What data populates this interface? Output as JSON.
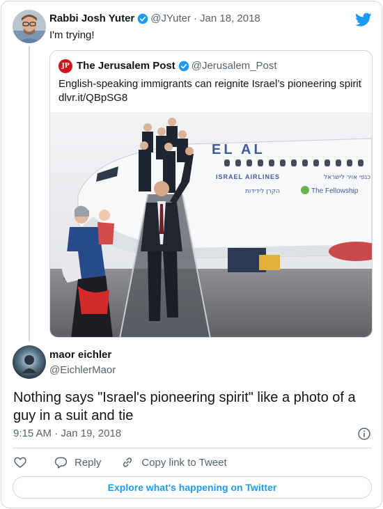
{
  "parent": {
    "name": "Rabbi Josh Yuter",
    "handle": "@JYuter",
    "separator": "·",
    "date": "Jan 18, 2018",
    "text": "I'm trying!"
  },
  "quoted": {
    "name": "The Jerusalem Post",
    "handle": "@Jerusalem_Post",
    "logo_text": "JP",
    "text": "English-speaking immigrants can reignite Israel’s pioneering spirit",
    "link": "dlvr.it/QBpSG8",
    "photo": {
      "airline_logo": "EL AL",
      "airline_name": "ISRAEL AIRLINES",
      "partner": "The Fellowship",
      "partner_hebrew": "הקרן לידידות",
      "hebrew_slogan": "כנפי אויר לישראל"
    }
  },
  "reply": {
    "name": "maor eichler",
    "handle": "@EichlerMaor",
    "text": "Nothing says \"Israel's pioneering spirit\" like a photo of a guy in a suit and tie",
    "time": "9:15 AM",
    "separator": "·",
    "date": "Jan 19, 2018"
  },
  "actions": {
    "like_label": "",
    "reply_label": "Reply",
    "copy_label": "Copy link to Tweet"
  },
  "explore_label": "Explore what's happening on Twitter",
  "colors": {
    "accent": "#1d9bf0",
    "text": "#0f1419",
    "muted": "#536471",
    "border": "#cfd9de",
    "jpost_red": "#d4121a"
  },
  "icons": [
    "twitter-bird-icon",
    "verified-badge-icon",
    "info-icon",
    "heart-icon",
    "reply-bubble-icon",
    "link-icon"
  ]
}
